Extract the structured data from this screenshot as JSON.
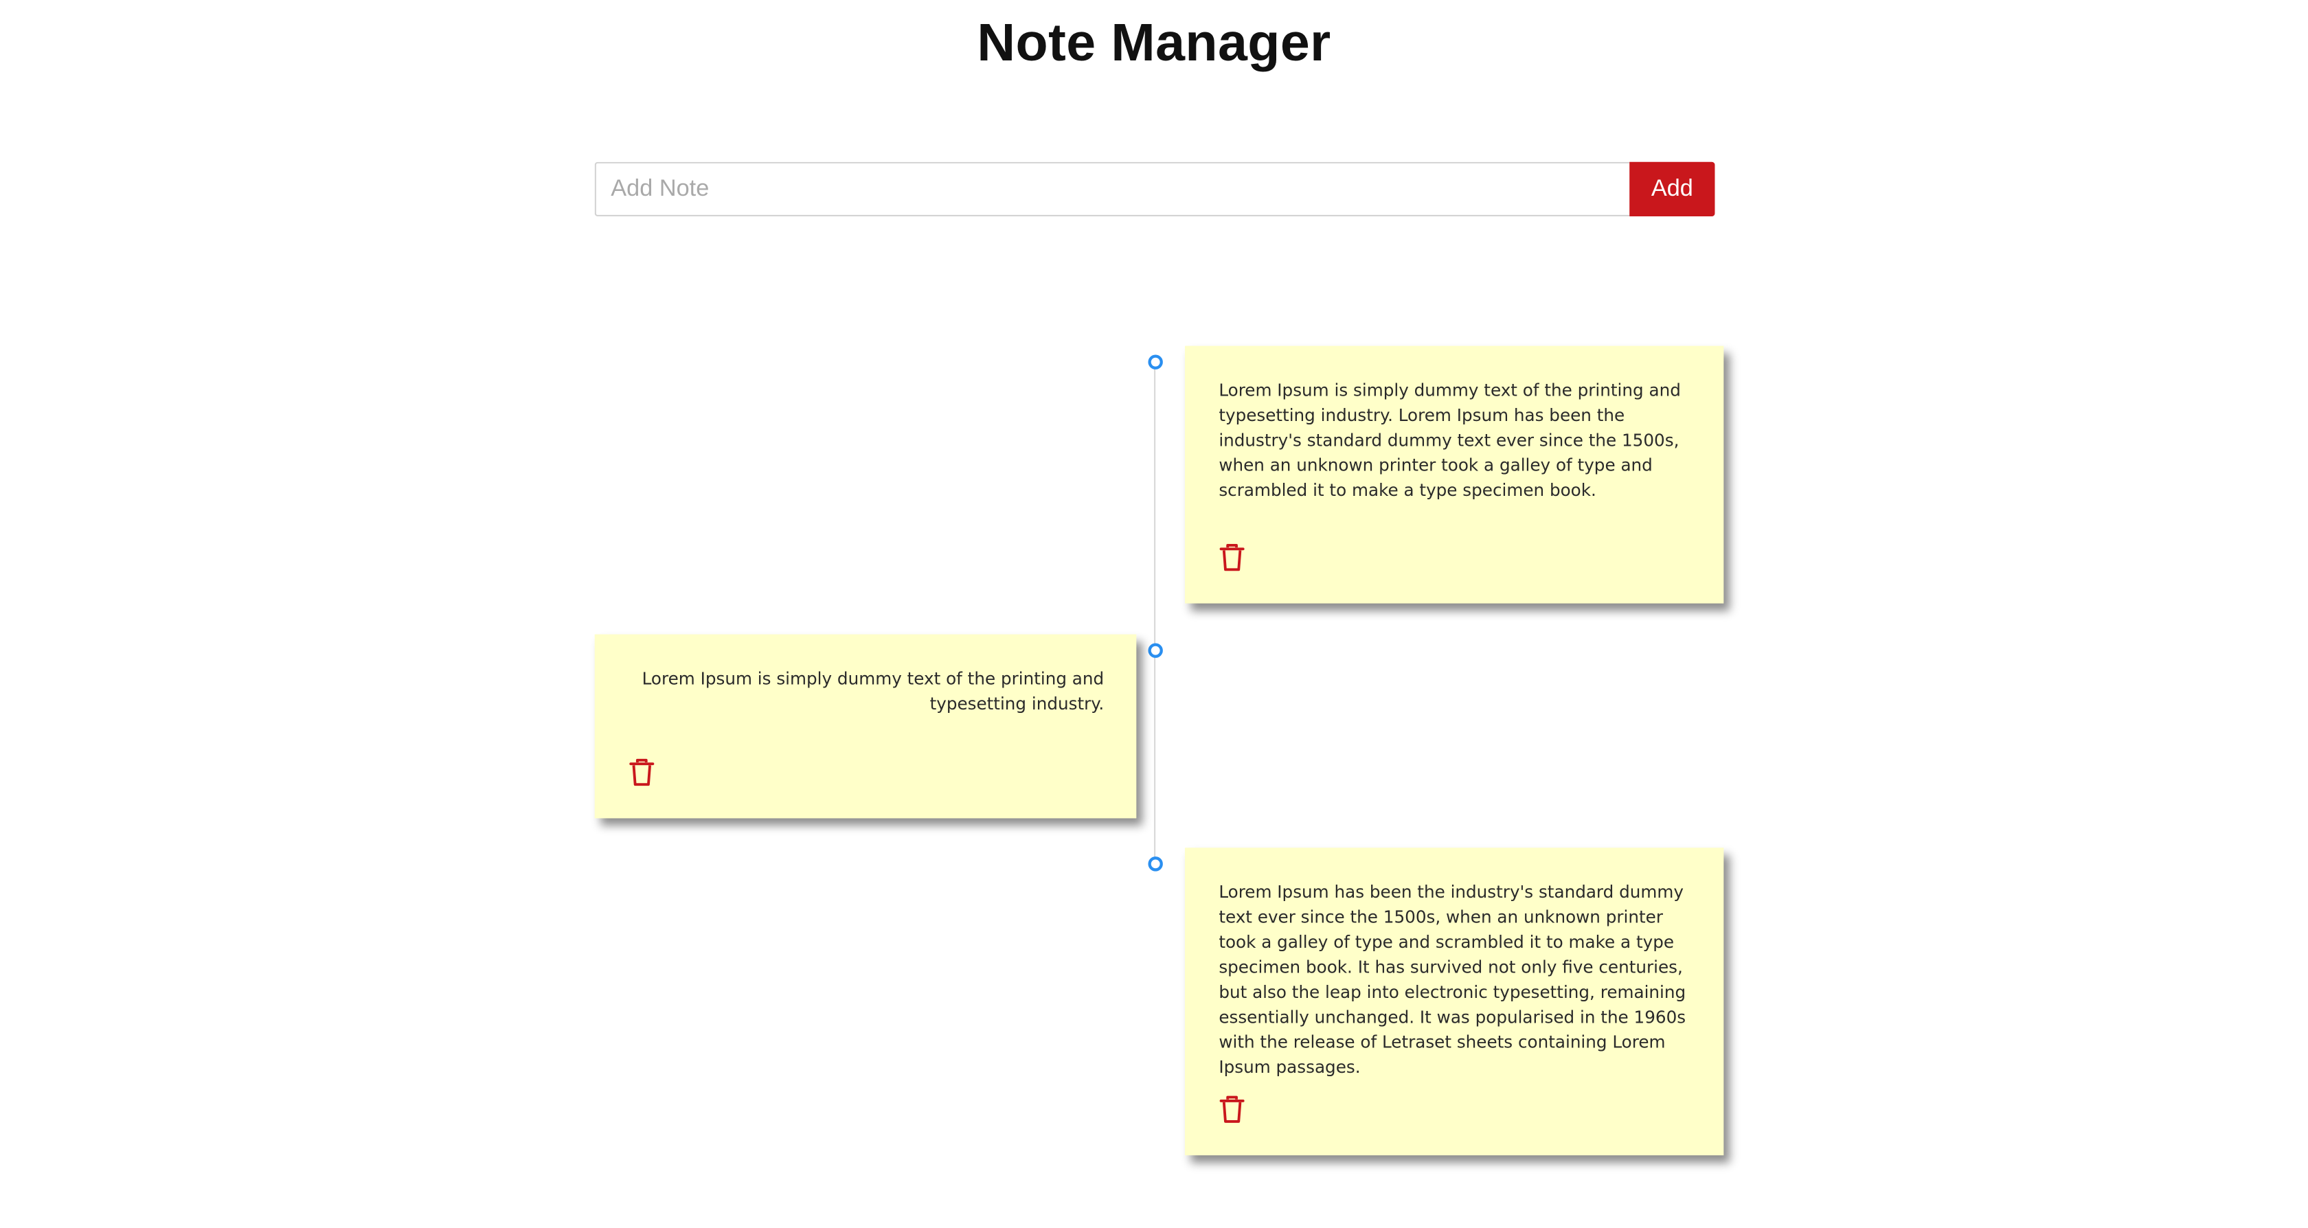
{
  "app": {
    "title": "Note Manager"
  },
  "composer": {
    "placeholder": "Add Note",
    "value": "",
    "add_label": "Add"
  },
  "notes": [
    {
      "side": "right",
      "text": "Lorem Ipsum is simply dummy text of the printing and typesetting industry. Lorem Ipsum has been the industry's standard dummy text ever since the 1500s, when an unknown printer took a galley of type and scrambled it to make a type specimen book.",
      "delete_icon": "trash-icon"
    },
    {
      "side": "left",
      "text": "Lorem Ipsum is simply dummy text of the printing and typesetting industry.",
      "delete_icon": "trash-icon"
    },
    {
      "side": "right",
      "text": "Lorem Ipsum has been the industry's standard dummy text ever since the 1500s, when an unknown printer took a galley of type and scrambled it to make a type specimen book. It has survived not only five centuries, but also the leap into electronic typesetting, remaining essentially unchanged. It was popularised in the 1960s with the release of Letraset sheets containing Lorem Ipsum passages.",
      "delete_icon": "trash-icon"
    }
  ],
  "colors": {
    "accent": "#c9171c",
    "note_background": "#ffffc9",
    "timeline_dot": "#2a8ff0"
  }
}
